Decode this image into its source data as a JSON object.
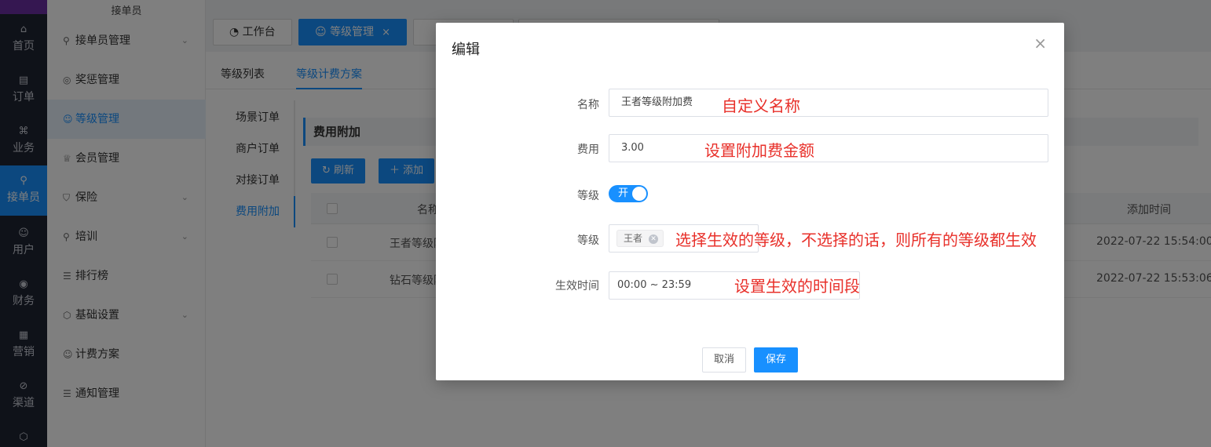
{
  "rail": {
    "items": [
      {
        "label": "首页",
        "icon": "home-icon"
      },
      {
        "label": "订单",
        "icon": "document-icon"
      },
      {
        "label": "业务",
        "icon": "grid-icon"
      },
      {
        "label": "接单员",
        "icon": "bike-icon"
      },
      {
        "label": "用户",
        "icon": "user-icon"
      },
      {
        "label": "财务",
        "icon": "coin-icon"
      },
      {
        "label": "营销",
        "icon": "chart-icon"
      },
      {
        "label": "渠道",
        "icon": "compass-icon"
      }
    ]
  },
  "submenu": {
    "title": "接单员",
    "items": [
      {
        "label": "接单员管理"
      },
      {
        "label": "奖惩管理"
      },
      {
        "label": "等级管理"
      },
      {
        "label": "会员管理"
      },
      {
        "label": "保险"
      },
      {
        "label": "培训"
      },
      {
        "label": "排行榜"
      },
      {
        "label": "基础设置"
      },
      {
        "label": "计费方案"
      },
      {
        "label": "通知管理"
      }
    ]
  },
  "top_tabs": {
    "workbench": "工作台",
    "level_mgmt": "等级管理",
    "close": "×"
  },
  "content_tabs": [
    "等级列表",
    "等级计费方案"
  ],
  "side_nav": [
    "场景订单",
    "商户订单",
    "对接订单",
    "费用附加"
  ],
  "section": {
    "title": "费用附加"
  },
  "toolbar": {
    "refresh": "刷新",
    "add": "添加"
  },
  "table": {
    "headers": {
      "name": "名称",
      "added_time": "添加时间"
    },
    "rows": [
      {
        "name": "王者等级附",
        "added_time": "2022-07-22 15:54:00"
      },
      {
        "name": "钻石等级附",
        "added_time": "2022-07-22 15:53:06"
      }
    ]
  },
  "modal": {
    "title": "编辑",
    "close": "×",
    "fields": {
      "name_label": "名称",
      "name_value": "王者等级附加费",
      "fee_label": "费用",
      "fee_value": "3.00",
      "level_switch_label": "等级",
      "switch_text": "开",
      "level_select_label": "等级",
      "level_tag": "王者",
      "time_label": "生效时间",
      "time_value": "00:00 ~ 23:59"
    },
    "annotations": {
      "name": "自定义名称",
      "fee": "设置附加费金额",
      "level": "选择生效的等级，不选择的话，则所有的等级都生效",
      "time": "设置生效的时间段"
    },
    "buttons": {
      "cancel": "取消",
      "save": "保存"
    }
  },
  "colors": {
    "primary": "#1890ff",
    "annotation": "#e8302a",
    "rail_bg": "#1f2433"
  }
}
